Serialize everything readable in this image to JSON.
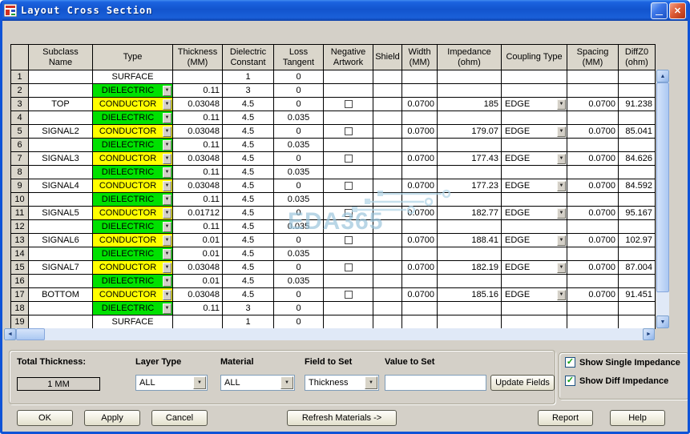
{
  "window": {
    "title": "Layout Cross Section"
  },
  "icons": {
    "dropdown_arrow": "▼",
    "checkmark": "✓",
    "scroll_up": "▲",
    "scroll_down": "▼",
    "scroll_left": "◄",
    "scroll_right": "►",
    "minimize": "—",
    "close": "✕"
  },
  "colors": {
    "dielectric_green": "#00e100",
    "conductor_yellow": "#ffff00",
    "titlebar_blue": "#1254cd",
    "watermark_blue": "#9cc6dc"
  },
  "watermark": {
    "text": "EDA365"
  },
  "table": {
    "headers": [
      [
        ""
      ],
      [
        "Subclass",
        "Name"
      ],
      [
        "Type"
      ],
      [
        "Thickness",
        "(MM)"
      ],
      [
        "Dielectric",
        "Constant"
      ],
      [
        "Loss",
        "Tangent"
      ],
      [
        "Negative",
        "Artwork"
      ],
      [
        "Shield"
      ],
      [
        "Width",
        "(MM)"
      ],
      [
        "Impedance",
        "(ohm)"
      ],
      [
        "Coupling Type"
      ],
      [
        "Spacing",
        "(MM)"
      ],
      [
        "DiffZ0",
        "(ohm)"
      ]
    ],
    "rows": [
      {
        "n": "1",
        "subclass": "",
        "type": "SURFACE",
        "kind": "surface",
        "thickness": "",
        "dk": "1",
        "loss": "0",
        "neg": null,
        "width": "",
        "imp": "",
        "coupling": "",
        "spacing": "",
        "diffz0": ""
      },
      {
        "n": "2",
        "subclass": "",
        "type": "DIELECTRIC",
        "kind": "dielectric",
        "thickness": "0.11",
        "dk": "3",
        "loss": "0",
        "neg": null,
        "width": "",
        "imp": "",
        "coupling": "",
        "spacing": "",
        "diffz0": ""
      },
      {
        "n": "3",
        "subclass": "TOP",
        "type": "CONDUCTOR",
        "kind": "conductor",
        "thickness": "0.03048",
        "dk": "4.5",
        "loss": "0",
        "neg": false,
        "width": "0.0700",
        "imp": "185",
        "coupling": "EDGE",
        "spacing": "0.0700",
        "diffz0": "91.238"
      },
      {
        "n": "4",
        "subclass": "",
        "type": "DIELECTRIC",
        "kind": "dielectric",
        "thickness": "0.11",
        "dk": "4.5",
        "loss": "0.035",
        "neg": null,
        "width": "",
        "imp": "",
        "coupling": "",
        "spacing": "",
        "diffz0": ""
      },
      {
        "n": "5",
        "subclass": "SIGNAL2",
        "type": "CONDUCTOR",
        "kind": "conductor",
        "thickness": "0.03048",
        "dk": "4.5",
        "loss": "0",
        "neg": false,
        "width": "0.0700",
        "imp": "179.07",
        "coupling": "EDGE",
        "spacing": "0.0700",
        "diffz0": "85.041"
      },
      {
        "n": "6",
        "subclass": "",
        "type": "DIELECTRIC",
        "kind": "dielectric",
        "thickness": "0.11",
        "dk": "4.5",
        "loss": "0.035",
        "neg": null,
        "width": "",
        "imp": "",
        "coupling": "",
        "spacing": "",
        "diffz0": ""
      },
      {
        "n": "7",
        "subclass": "SIGNAL3",
        "type": "CONDUCTOR",
        "kind": "conductor",
        "thickness": "0.03048",
        "dk": "4.5",
        "loss": "0",
        "neg": false,
        "width": "0.0700",
        "imp": "177.43",
        "coupling": "EDGE",
        "spacing": "0.0700",
        "diffz0": "84.626"
      },
      {
        "n": "8",
        "subclass": "",
        "type": "DIELECTRIC",
        "kind": "dielectric",
        "thickness": "0.11",
        "dk": "4.5",
        "loss": "0.035",
        "neg": null,
        "width": "",
        "imp": "",
        "coupling": "",
        "spacing": "",
        "diffz0": ""
      },
      {
        "n": "9",
        "subclass": "SIGNAL4",
        "type": "CONDUCTOR",
        "kind": "conductor",
        "thickness": "0.03048",
        "dk": "4.5",
        "loss": "0",
        "neg": false,
        "width": "0.0700",
        "imp": "177.23",
        "coupling": "EDGE",
        "spacing": "0.0700",
        "diffz0": "84.592"
      },
      {
        "n": "10",
        "subclass": "",
        "type": "DIELECTRIC",
        "kind": "dielectric",
        "thickness": "0.11",
        "dk": "4.5",
        "loss": "0.035",
        "neg": null,
        "width": "",
        "imp": "",
        "coupling": "",
        "spacing": "",
        "diffz0": ""
      },
      {
        "n": "11",
        "subclass": "SIGNAL5",
        "type": "CONDUCTOR",
        "kind": "conductor",
        "thickness": "0.01712",
        "dk": "4.5",
        "loss": "0",
        "neg": false,
        "width": "0.0700",
        "imp": "182.77",
        "coupling": "EDGE",
        "spacing": "0.0700",
        "diffz0": "95.167"
      },
      {
        "n": "12",
        "subclass": "",
        "type": "DIELECTRIC",
        "kind": "dielectric",
        "thickness": "0.11",
        "dk": "4.5",
        "loss": "0.035",
        "neg": null,
        "width": "",
        "imp": "",
        "coupling": "",
        "spacing": "",
        "diffz0": ""
      },
      {
        "n": "13",
        "subclass": "SIGNAL6",
        "type": "CONDUCTOR",
        "kind": "conductor",
        "thickness": "0.01",
        "dk": "4.5",
        "loss": "0",
        "neg": false,
        "width": "0.0700",
        "imp": "188.41",
        "coupling": "EDGE",
        "spacing": "0.0700",
        "diffz0": "102.97"
      },
      {
        "n": "14",
        "subclass": "",
        "type": "DIELECTRIC",
        "kind": "dielectric",
        "thickness": "0.01",
        "dk": "4.5",
        "loss": "0.035",
        "neg": null,
        "width": "",
        "imp": "",
        "coupling": "",
        "spacing": "",
        "diffz0": ""
      },
      {
        "n": "15",
        "subclass": "SIGNAL7",
        "type": "CONDUCTOR",
        "kind": "conductor",
        "thickness": "0.03048",
        "dk": "4.5",
        "loss": "0",
        "neg": false,
        "width": "0.0700",
        "imp": "182.19",
        "coupling": "EDGE",
        "spacing": "0.0700",
        "diffz0": "87.004"
      },
      {
        "n": "16",
        "subclass": "",
        "type": "DIELECTRIC",
        "kind": "dielectric",
        "thickness": "0.01",
        "dk": "4.5",
        "loss": "0.035",
        "neg": null,
        "width": "",
        "imp": "",
        "coupling": "",
        "spacing": "",
        "diffz0": ""
      },
      {
        "n": "17",
        "subclass": "BOTTOM",
        "type": "CONDUCTOR",
        "kind": "conductor",
        "thickness": "0.03048",
        "dk": "4.5",
        "loss": "0",
        "neg": false,
        "width": "0.0700",
        "imp": "185.16",
        "coupling": "EDGE",
        "spacing": "0.0700",
        "diffz0": "91.451"
      },
      {
        "n": "18",
        "subclass": "",
        "type": "DIELECTRIC",
        "kind": "dielectric",
        "thickness": "0.11",
        "dk": "3",
        "loss": "0",
        "neg": null,
        "width": "",
        "imp": "",
        "coupling": "",
        "spacing": "",
        "diffz0": ""
      },
      {
        "n": "19",
        "subclass": "",
        "type": "SURFACE",
        "kind": "surface",
        "thickness": "",
        "dk": "1",
        "loss": "0",
        "neg": null,
        "width": "",
        "imp": "",
        "coupling": "",
        "spacing": "",
        "diffz0": ""
      }
    ]
  },
  "controls": {
    "total_thickness_label": "Total Thickness:",
    "total_thickness_value": "1 MM",
    "layer_type_label": "Layer Type",
    "layer_type_value": "ALL",
    "material_label": "Material",
    "material_value": "ALL",
    "field_to_set_label": "Field to Set",
    "field_to_set_value": "Thickness",
    "value_to_set_label": "Value to Set",
    "value_to_set_value": "",
    "update_fields_button": "Update Fields",
    "show_single_impedance": {
      "label": "Show Single Impedance",
      "checked": true
    },
    "show_diff_impedance": {
      "label": "Show Diff Impedance",
      "checked": true
    }
  },
  "buttons": {
    "ok": "OK",
    "apply": "Apply",
    "cancel": "Cancel",
    "refresh": "Refresh Materials ->",
    "report": "Report",
    "help": "Help"
  }
}
